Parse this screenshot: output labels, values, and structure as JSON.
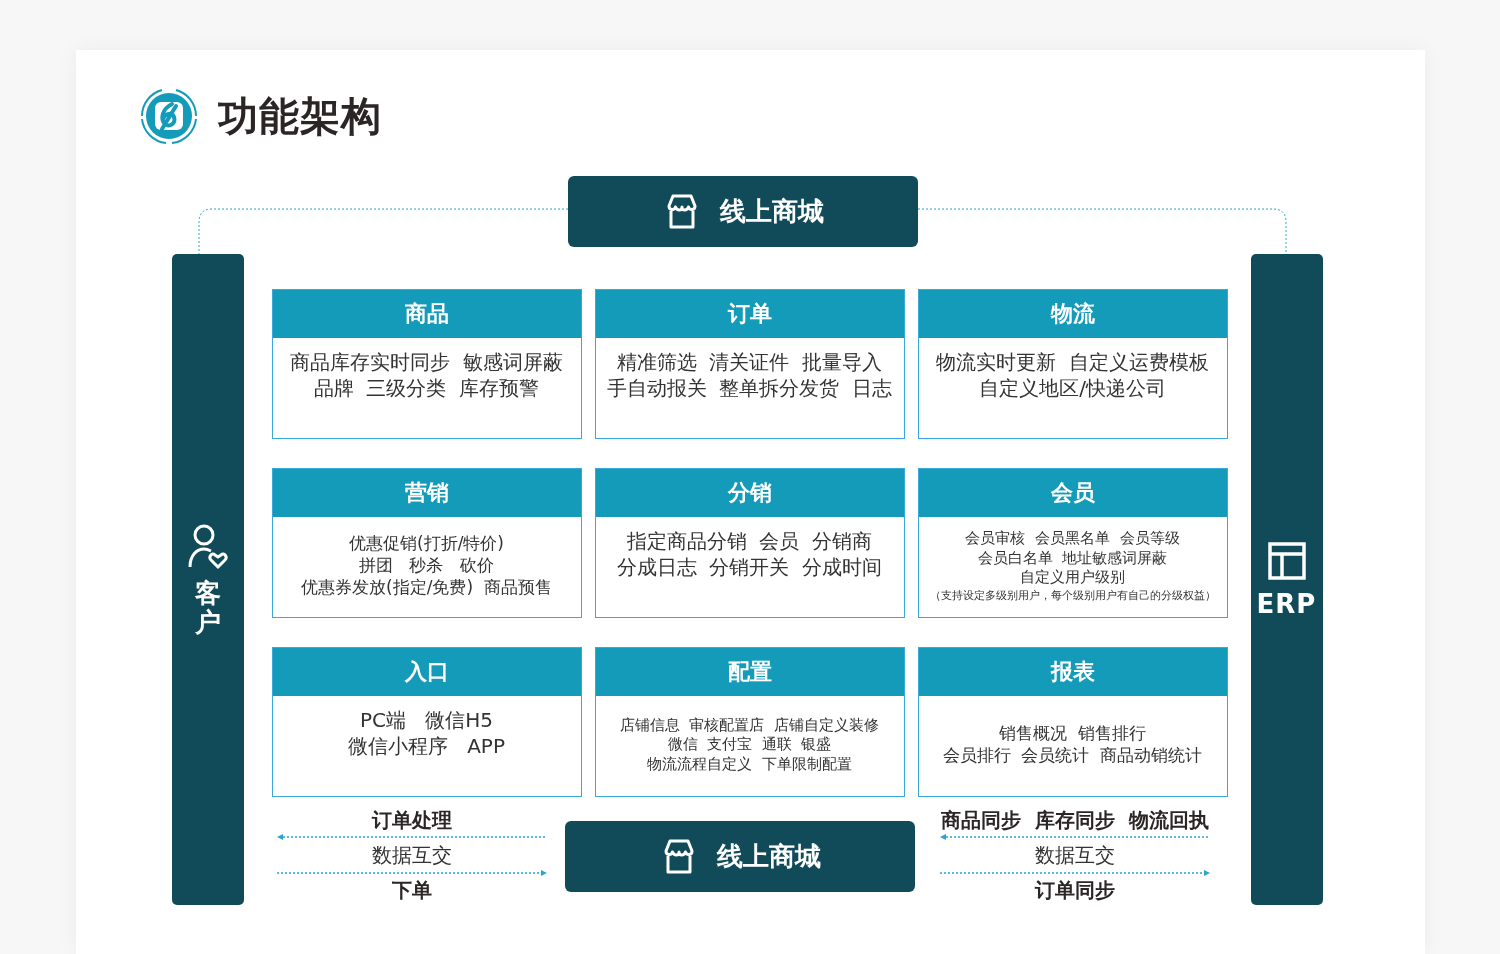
{
  "title": "功能架构",
  "top_hub": {
    "label": "线上商城"
  },
  "left_panel": {
    "label": "客户"
  },
  "right_panel": {
    "label": "ERP"
  },
  "modules": [
    {
      "title": "商品",
      "kind": "large",
      "lines": [
        "商品库存实时同步  敏感词屏蔽",
        "品牌  三级分类  库存预警"
      ]
    },
    {
      "title": "订单",
      "kind": "large",
      "lines": [
        "精准筛选  清关证件  批量导入",
        "手自动报关  整单拆分发货  日志"
      ]
    },
    {
      "title": "物流",
      "kind": "large",
      "lines": [
        "物流实时更新  自定义运费模板",
        "自定义地区/快递公司"
      ]
    },
    {
      "title": "营销",
      "kind": "medium",
      "lines": [
        "优惠促销(打折/特价)",
        "拼团   秒杀   砍价",
        "优惠券发放(指定/免费)  商品预售"
      ]
    },
    {
      "title": "分销",
      "kind": "large",
      "lines": [
        "指定商品分销  会员  分销商",
        "分成日志  分销开关  分成时间"
      ]
    },
    {
      "title": "会员",
      "kind": "small",
      "lines": [
        "会员审核  会员黑名单  会员等级",
        "会员白名单  地址敏感词屏蔽",
        "自定义用户级别"
      ],
      "note": "（支持设定多级别用户，每个级别用户有自己的分级权益）"
    },
    {
      "title": "入口",
      "kind": "large",
      "lines": [
        "PC端   微信H5",
        "微信小程序   APP"
      ]
    },
    {
      "title": "配置",
      "kind": "small",
      "lines": [
        "店铺信息  审核配置店  店铺自定义装修",
        "微信  支付宝  通联  银盛",
        "物流流程自定义  下单限制配置"
      ]
    },
    {
      "title": "报表",
      "kind": "medium",
      "lines": [
        "销售概况  销售排行",
        "会员排行  会员统计  商品动销统计"
      ]
    }
  ],
  "bottom_hub": {
    "label": "线上商城"
  },
  "flows": [
    {
      "top_label": "订单处理",
      "middle_label": "数据互交",
      "bottom_label": "下单"
    },
    {
      "top_label": "商品同步  库存同步  物流回执",
      "middle_label": "数据互交",
      "bottom_label": "订单同步"
    }
  ]
}
